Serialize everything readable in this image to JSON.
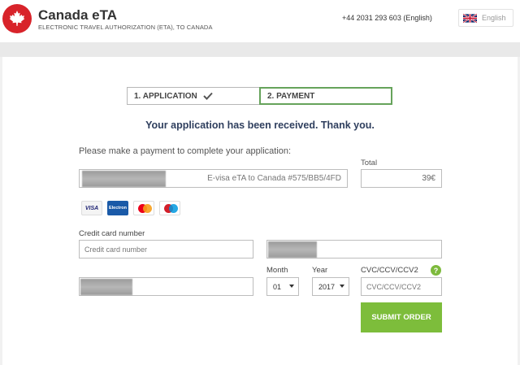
{
  "header": {
    "brand_title": "Canada eTA",
    "brand_subtitle": "ELECTRONIC TRAVEL AUTHORIZATION (ETA), TO CANADA",
    "phone": "+44 2031 293 603 (English)",
    "language": "English",
    "logo_icon": "maple-leaf-icon",
    "brand_color": "#d8232a"
  },
  "steps": [
    {
      "label": "1. APPLICATION",
      "done": true
    },
    {
      "label": "2. PAYMENT",
      "active": true
    }
  ],
  "main": {
    "received_message": "Your application has been received. Thank you.",
    "instruction": "Please make a payment to complete your application:",
    "product": "E-visa eTA to Canada #575/BB5/4FD",
    "total_label": "Total",
    "total_value": "39€",
    "card_logos": [
      "VISA",
      "Electron",
      "MasterCard",
      "Maestro"
    ]
  },
  "form": {
    "card_number_label": "Credit card number",
    "card_number_placeholder": "Credit card number",
    "month_label": "Month",
    "month_value": "01",
    "year_label": "Year",
    "year_value": "2017",
    "cvc_label": "CVC/CCV/CCV2",
    "cvc_placeholder": "CVC/CCV/CCV2",
    "help_glyph": "?",
    "submit_label": "SUBMIT ORDER",
    "accent_color": "#7dbd3b"
  }
}
